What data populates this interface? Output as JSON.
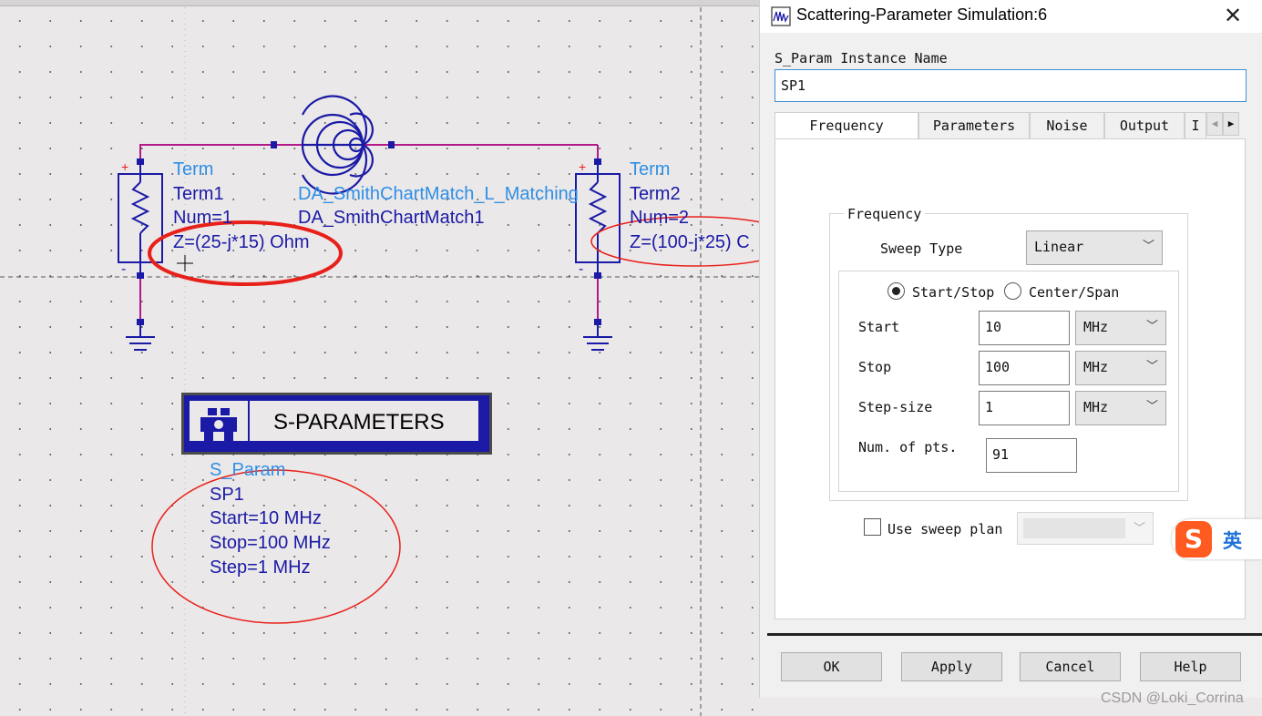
{
  "dialog": {
    "title": "Scattering-Parameter Simulation:6",
    "instance_name_label": "S_Param Instance Name",
    "instance_name_value": "SP1",
    "tabs": [
      "Frequency",
      "Parameters",
      "Noise",
      "Output",
      "I"
    ],
    "active_tab": "Frequency",
    "frequency_group_title": "Frequency",
    "sweep_type_label": "Sweep Type",
    "sweep_type_value": "Linear",
    "radio_start_stop": "Start/Stop",
    "radio_center_span": "Center/Span",
    "selected_mode": "Start/Stop",
    "start_label": "Start",
    "start_value": "10",
    "start_unit": "MHz",
    "stop_label": "Stop",
    "stop_value": "100",
    "stop_unit": "MHz",
    "step_label": "Step-size",
    "step_value": "1",
    "step_unit": "MHz",
    "num_pts_label": "Num. of pts.",
    "num_pts_value": "91",
    "use_sweep_plan_label": "Use sweep plan",
    "use_sweep_plan_checked": false,
    "buttons": {
      "ok": "OK",
      "apply": "Apply",
      "cancel": "Cancel",
      "help": "Help"
    }
  },
  "schematic": {
    "term1": {
      "type": "Term",
      "name": "Term1",
      "num": "Num=1",
      "z": "Z=(25-j*15) Ohm"
    },
    "term2": {
      "type": "Term",
      "name": "Term2",
      "num": "Num=2",
      "z": "Z=(100-j*25) C"
    },
    "matcher": {
      "type": "DA_SmithChartMatch_L_Matching",
      "name": "DA_SmithChartMatch1"
    },
    "sparam": {
      "block_title": "S-PARAMETERS",
      "type": "S_Param",
      "name": "SP1",
      "start": "Start=10 MHz",
      "stop": "Stop=100 MHz",
      "step": "Step=1 MHz"
    },
    "colors": {
      "wire": "#b21a8a",
      "component": "#1a1aa6",
      "annotation": "#e8201a",
      "label_name": "#2e8fe6"
    }
  },
  "ime": {
    "logo": "S",
    "mode": "英"
  },
  "watermark": "CSDN @Loki_Corrina"
}
